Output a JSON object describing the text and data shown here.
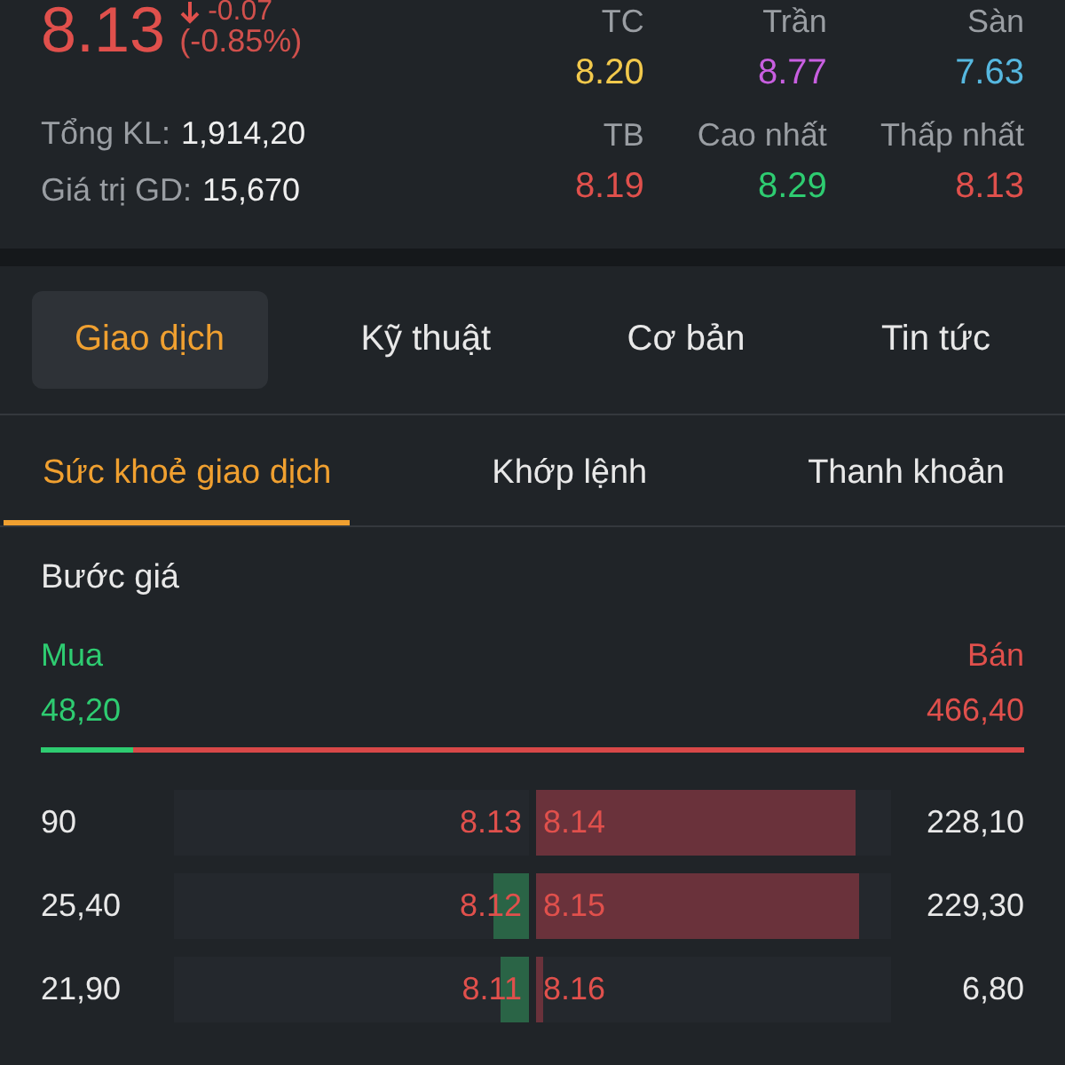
{
  "quote": {
    "price": "8.13",
    "change": "-0.07",
    "change_pct": "(-0.85%)",
    "volume_label": "Tổng KL:",
    "volume": "1,914,20",
    "value_label": "Giá trị GD:",
    "value": "15,670"
  },
  "stats": [
    {
      "label": "TC",
      "value": "8.20",
      "color": "#f2c94c"
    },
    {
      "label": "Trần",
      "value": "8.77",
      "color": "#c85fe0"
    },
    {
      "label": "Sàn",
      "value": "7.63",
      "color": "#56b8e0"
    },
    {
      "label": "TB",
      "value": "8.19",
      "color": "#e0504c"
    },
    {
      "label": "Cao nhất",
      "value": "8.29",
      "color": "#2ecc71"
    },
    {
      "label": "Thấp nhất",
      "value": "8.13",
      "color": "#e0504c"
    }
  ],
  "tabs": [
    {
      "label": "Giao dịch",
      "selected": true
    },
    {
      "label": "Kỹ thuật",
      "selected": false
    },
    {
      "label": "Cơ bản",
      "selected": false
    },
    {
      "label": "Tin tức",
      "selected": false
    }
  ],
  "subtabs": [
    {
      "label": "Sức khoẻ giao dịch",
      "selected": true
    },
    {
      "label": "Khớp lệnh",
      "selected": false
    },
    {
      "label": "Thanh khoản",
      "selected": false
    }
  ],
  "price_step": {
    "title": "Bước giá",
    "buy_label": "Mua",
    "sell_label": "Bán",
    "buy_total": "48,20",
    "sell_total": "466,40",
    "level": 0.094
  },
  "order_book": [
    {
      "bid": {
        "volume": "90",
        "price": "8.13",
        "level": 0
      },
      "ask": {
        "price": "8.14",
        "level": 0.9,
        "volume": "228,10"
      }
    },
    {
      "bid": {
        "volume": "25,40",
        "price": "8.12",
        "level": 0.1
      },
      "ask": {
        "price": "8.15",
        "level": 0.91,
        "volume": "229,30"
      }
    },
    {
      "bid": {
        "volume": "21,90",
        "price": "8.11",
        "level": 0.08
      },
      "ask": {
        "price": "8.16",
        "level": 0.02,
        "volume": "6,80"
      }
    }
  ]
}
